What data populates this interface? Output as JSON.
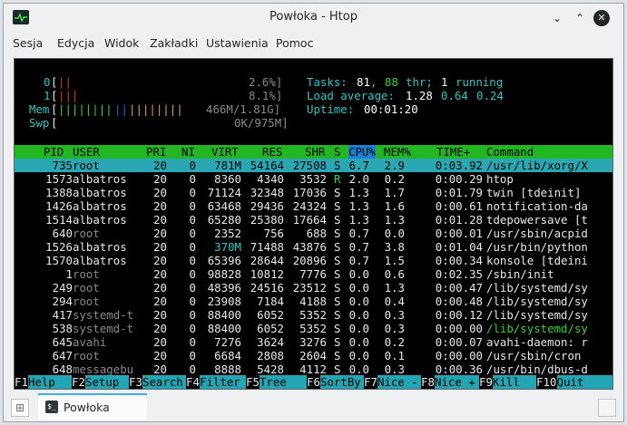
{
  "window": {
    "title": "Powłoka - Htop"
  },
  "menu": [
    "Sesja",
    "Edycja",
    "Widok",
    "Zakładki",
    "Ustawienia",
    "Pomoc"
  ],
  "meters": {
    "cpu0": {
      "label": "0",
      "bar_left": "[",
      "bars": "||",
      "pct": "2.6%]"
    },
    "cpu1": {
      "label": "1",
      "bar_left": "[",
      "bars": "|||",
      "pct": "8.1%]"
    },
    "mem": {
      "label": "Mem",
      "bar_left": "[",
      "bars_green": "||||||||",
      "bars_blue": "||",
      "bars_orange": "||||||||",
      "value": "466M/1.81G]"
    },
    "swp": {
      "label": "Swp",
      "bar_left": "[",
      "value": "0K/975M]"
    }
  },
  "stats": {
    "tasks_label": "Tasks:",
    "tasks": "81",
    "sep1": ",",
    "thr": "88",
    "thr_label": "thr;",
    "running": "1",
    "running_label": "running",
    "load_label": "Load average:",
    "load1": "1.28",
    "load5": "0.64",
    "load15": "0.24",
    "uptime_label": "Uptime:",
    "uptime": "00:01:20"
  },
  "columns": [
    "PID",
    "USER",
    "PRI",
    "NI",
    "VIRT",
    "RES",
    "SHR",
    "S",
    "CPU%",
    "MEM%",
    "TIME+",
    "Command"
  ],
  "processes": [
    {
      "pid": "735",
      "user": "root",
      "pri": "20",
      "ni": "0",
      "virt": "781M",
      "res": "54164",
      "shr": "27508",
      "s": "S",
      "cpu": "6.7",
      "mem": "2.9",
      "time": "0:03.92",
      "cmd": "/usr/lib/xorg/X",
      "selected": true
    },
    {
      "pid": "1573",
      "user": "albatros",
      "pri": "20",
      "ni": "0",
      "virt": "8360",
      "res": "4340",
      "shr": "3532",
      "s": "R",
      "cpu": "2.0",
      "mem": "0.2",
      "time": "0:00.29",
      "cmd": "htop"
    },
    {
      "pid": "1388",
      "user": "albatros",
      "pri": "20",
      "ni": "0",
      "virt": "71124",
      "res": "32348",
      "shr": "17036",
      "s": "S",
      "cpu": "1.3",
      "mem": "1.7",
      "time": "0:01.79",
      "cmd": "twin [tdeinit]"
    },
    {
      "pid": "1426",
      "user": "albatros",
      "pri": "20",
      "ni": "0",
      "virt": "63468",
      "res": "29436",
      "shr": "24324",
      "s": "S",
      "cpu": "1.3",
      "mem": "1.6",
      "time": "0:00.61",
      "cmd": "notification-da"
    },
    {
      "pid": "1514",
      "user": "albatros",
      "pri": "20",
      "ni": "0",
      "virt": "65280",
      "res": "25380",
      "shr": "17664",
      "s": "S",
      "cpu": "1.3",
      "mem": "1.3",
      "time": "0:01.28",
      "cmd": "tdepowersave [t"
    },
    {
      "pid": "640",
      "user": "root",
      "pri": "20",
      "ni": "0",
      "virt": "2352",
      "res": "756",
      "shr": "688",
      "s": "S",
      "cpu": "0.7",
      "mem": "0.0",
      "time": "0:00.01",
      "cmd": "/usr/sbin/acpid"
    },
    {
      "pid": "1526",
      "user": "albatros",
      "pri": "20",
      "ni": "0",
      "virt": "370M",
      "res": "71488",
      "shr": "43876",
      "s": "S",
      "cpu": "0.7",
      "mem": "3.8",
      "time": "0:01.04",
      "cmd": "/usr/bin/python"
    },
    {
      "pid": "1570",
      "user": "albatros",
      "pri": "20",
      "ni": "0",
      "virt": "65396",
      "res": "28644",
      "shr": "20896",
      "s": "S",
      "cpu": "0.7",
      "mem": "1.5",
      "time": "0:00.34",
      "cmd": "konsole [tdeini"
    },
    {
      "pid": "1",
      "user": "root",
      "pri": "20",
      "ni": "0",
      "virt": "98828",
      "res": "10812",
      "shr": "7776",
      "s": "S",
      "cpu": "0.0",
      "mem": "0.6",
      "time": "0:02.35",
      "cmd": "/sbin/init"
    },
    {
      "pid": "249",
      "user": "root",
      "pri": "20",
      "ni": "0",
      "virt": "48396",
      "res": "24516",
      "shr": "23512",
      "s": "S",
      "cpu": "0.0",
      "mem": "1.3",
      "time": "0:00.47",
      "cmd": "/lib/systemd/sy"
    },
    {
      "pid": "294",
      "user": "root",
      "pri": "20",
      "ni": "0",
      "virt": "23908",
      "res": "7184",
      "shr": "4188",
      "s": "S",
      "cpu": "0.0",
      "mem": "0.4",
      "time": "0:00.48",
      "cmd": "/lib/systemd/sy"
    },
    {
      "pid": "417",
      "user": "systemd-t",
      "pri": "20",
      "ni": "0",
      "virt": "88400",
      "res": "6052",
      "shr": "5352",
      "s": "S",
      "cpu": "0.0",
      "mem": "0.3",
      "time": "0:00.12",
      "cmd": "/lib/systemd/sy"
    },
    {
      "pid": "538",
      "user": "systemd-t",
      "pri": "20",
      "ni": "0",
      "virt": "88400",
      "res": "6052",
      "shr": "5352",
      "s": "S",
      "cpu": "0.0",
      "mem": "0.3",
      "time": "0:00.00",
      "cmd": "/lib/systemd/sy",
      "thread": true
    },
    {
      "pid": "645",
      "user": "avahi",
      "pri": "20",
      "ni": "0",
      "virt": "7276",
      "res": "3624",
      "shr": "3276",
      "s": "S",
      "cpu": "0.0",
      "mem": "0.2",
      "time": "0:00.07",
      "cmd": "avahi-daemon: r"
    },
    {
      "pid": "647",
      "user": "root",
      "pri": "20",
      "ni": "0",
      "virt": "6684",
      "res": "2808",
      "shr": "2604",
      "s": "S",
      "cpu": "0.0",
      "mem": "0.1",
      "time": "0:00.00",
      "cmd": "/usr/sbin/cron"
    },
    {
      "pid": "648",
      "user": "messagebu",
      "pri": "20",
      "ni": "0",
      "virt": "8888",
      "res": "5428",
      "shr": "4112",
      "s": "S",
      "cpu": "0.0",
      "mem": "0.3",
      "time": "0:00.36",
      "cmd": "/usr/bin/dbus-d"
    }
  ],
  "function_keys": [
    {
      "key": "F1",
      "label": "Help"
    },
    {
      "key": "F2",
      "label": "Setup"
    },
    {
      "key": "F3",
      "label": "Search"
    },
    {
      "key": "F4",
      "label": "Filter"
    },
    {
      "key": "F5",
      "label": "Tree"
    },
    {
      "key": "F6",
      "label": "SortBy"
    },
    {
      "key": "F7",
      "label": "Nice -"
    },
    {
      "key": "F8",
      "label": "Nice +"
    },
    {
      "key": "F9",
      "label": "Kill"
    },
    {
      "key": "F10",
      "label": "Quit"
    }
  ],
  "tabs": [
    {
      "label": "Powłoka"
    }
  ],
  "colors": {
    "header_bg": "#22b722",
    "selected_bg": "#2aa7b3",
    "fkey_bg": "#22a6b3",
    "terminal_bg": "#000000",
    "accent": "#3daee9"
  }
}
